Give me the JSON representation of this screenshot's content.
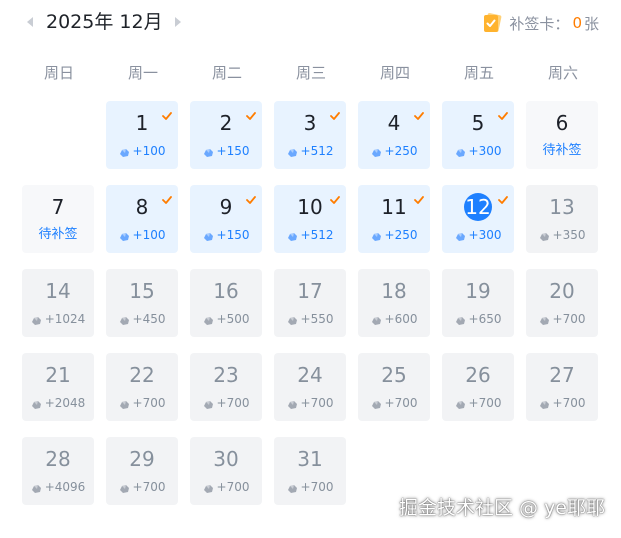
{
  "header": {
    "month_title": "2025年 12月",
    "makeup_label": "补签卡：",
    "makeup_count": "0",
    "makeup_unit": "张"
  },
  "weekdays": [
    "周日",
    "周一",
    "周二",
    "周三",
    "周四",
    "周五",
    "周六"
  ],
  "makeup_text": "待补签",
  "colors": {
    "accent": "#1e80ff",
    "signed_bg": "#e8f3ff",
    "future_bg": "#f2f3f5",
    "check": "#ff7d00"
  },
  "days": [
    {
      "day": "1",
      "status": "signed",
      "reward": "+100"
    },
    {
      "day": "2",
      "status": "signed",
      "reward": "+150"
    },
    {
      "day": "3",
      "status": "signed",
      "reward": "+512"
    },
    {
      "day": "4",
      "status": "signed",
      "reward": "+250"
    },
    {
      "day": "5",
      "status": "signed",
      "reward": "+300"
    },
    {
      "day": "6",
      "status": "makeup",
      "reward": ""
    },
    {
      "day": "7",
      "status": "makeup",
      "reward": ""
    },
    {
      "day": "8",
      "status": "signed",
      "reward": "+100"
    },
    {
      "day": "9",
      "status": "signed",
      "reward": "+150"
    },
    {
      "day": "10",
      "status": "signed",
      "reward": "+512"
    },
    {
      "day": "11",
      "status": "signed",
      "reward": "+250"
    },
    {
      "day": "12",
      "status": "today",
      "reward": "+300"
    },
    {
      "day": "13",
      "status": "future",
      "reward": "+350"
    },
    {
      "day": "14",
      "status": "future",
      "reward": "+1024"
    },
    {
      "day": "15",
      "status": "future",
      "reward": "+450"
    },
    {
      "day": "16",
      "status": "future",
      "reward": "+500"
    },
    {
      "day": "17",
      "status": "future",
      "reward": "+550"
    },
    {
      "day": "18",
      "status": "future",
      "reward": "+600"
    },
    {
      "day": "19",
      "status": "future",
      "reward": "+650"
    },
    {
      "day": "20",
      "status": "future",
      "reward": "+700"
    },
    {
      "day": "21",
      "status": "future",
      "reward": "+2048"
    },
    {
      "day": "22",
      "status": "future",
      "reward": "+700"
    },
    {
      "day": "23",
      "status": "future",
      "reward": "+700"
    },
    {
      "day": "24",
      "status": "future",
      "reward": "+700"
    },
    {
      "day": "25",
      "status": "future",
      "reward": "+700"
    },
    {
      "day": "26",
      "status": "future",
      "reward": "+700"
    },
    {
      "day": "27",
      "status": "future",
      "reward": "+700"
    },
    {
      "day": "28",
      "status": "future",
      "reward": "+4096"
    },
    {
      "day": "29",
      "status": "future",
      "reward": "+700"
    },
    {
      "day": "30",
      "status": "future",
      "reward": "+700"
    },
    {
      "day": "31",
      "status": "future",
      "reward": "+700"
    }
  ],
  "watermark": "掘金技术社区 @ ye耶耶"
}
